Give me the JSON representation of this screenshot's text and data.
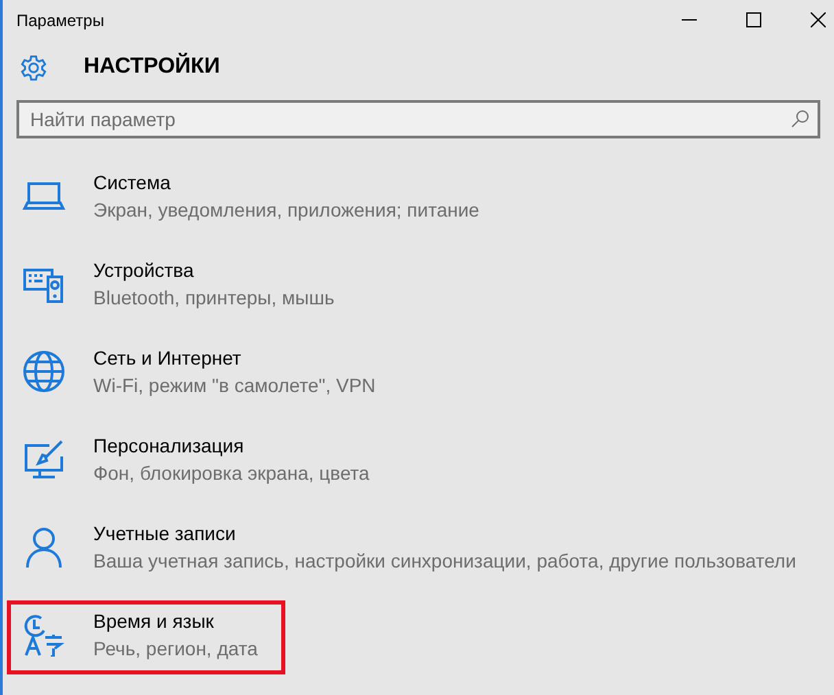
{
  "window": {
    "title": "Параметры"
  },
  "header": {
    "title": "НАСТРОЙКИ"
  },
  "search": {
    "placeholder": "Найти параметр"
  },
  "categories": [
    {
      "kind": "system",
      "title": "Система",
      "description": "Экран, уведомления, приложения; питание",
      "highlighted": false
    },
    {
      "kind": "devices",
      "title": "Устройства",
      "description": "Bluetooth, принтеры, мышь",
      "highlighted": false
    },
    {
      "kind": "network",
      "title": "Сеть и Интернет",
      "description": "Wi-Fi, режим \"в самолете\", VPN",
      "highlighted": false
    },
    {
      "kind": "personalization",
      "title": "Персонализация",
      "description": "Фон, блокировка экрана, цвета",
      "highlighted": false
    },
    {
      "kind": "accounts",
      "title": "Учетные записи",
      "description": "Ваша учетная запись, настройки синхронизации, работа, другие пользователи",
      "highlighted": false
    },
    {
      "kind": "time",
      "title": "Время и язык",
      "description": "Речь, регион, дата",
      "highlighted": true
    }
  ]
}
